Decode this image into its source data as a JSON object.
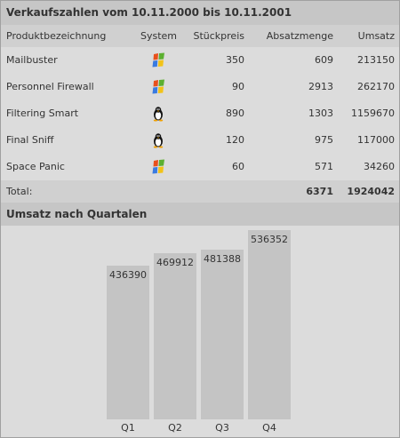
{
  "title": "Verkaufszahlen vom 10.11.2000 bis 10.11.2001",
  "columns": [
    "Produktbezeichnung",
    "System",
    "Stückpreis",
    "Absatzmenge",
    "Umsatz"
  ],
  "rows": [
    {
      "name": "Mailbuster",
      "system": "windows",
      "price": "350",
      "qty": "609",
      "revenue": "213150"
    },
    {
      "name": "Personnel Firewall",
      "system": "windows",
      "price": "90",
      "qty": "2913",
      "revenue": "262170"
    },
    {
      "name": "Filtering Smart",
      "system": "linux",
      "price": "890",
      "qty": "1303",
      "revenue": "1159670"
    },
    {
      "name": "Final Sniff",
      "system": "linux",
      "price": "120",
      "qty": "975",
      "revenue": "117000"
    },
    {
      "name": "Space Panic",
      "system": "windows",
      "price": "60",
      "qty": "571",
      "revenue": "34260"
    }
  ],
  "total": {
    "label": "Total:",
    "qty": "6371",
    "revenue": "1924042"
  },
  "chart_data": {
    "type": "bar",
    "title": "Umsatz nach Quartalen",
    "categories": [
      "Q1",
      "Q2",
      "Q3",
      "Q4"
    ],
    "values": [
      436390,
      469912,
      481388,
      536352
    ],
    "labels": [
      "436390",
      "469912",
      "481388",
      "536352"
    ],
    "bar_color": "#c4c4c4"
  }
}
